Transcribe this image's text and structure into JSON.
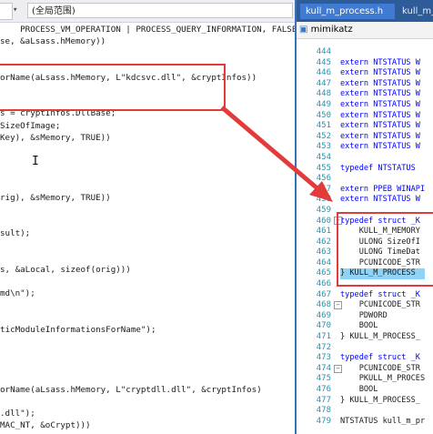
{
  "left_header": {
    "scope_label": "(全局范围)"
  },
  "left_code": [
    "    PROCESS_VM_OPERATION | PROCESS_QUERY_INFORMATION, FALSE, processId",
    "se, &aLsass.hMemory))",
    "",
    "",
    "orName(aLsass.hMemory, L\"kdcsvc.dll\", &cryptInfos))",
    "",
    "",
    "s = cryptInfos.DllBase;",
    "SizeOfImage;",
    "Key), &sMemory, TRUE))",
    "",
    "",
    "",
    "",
    "rig), &sMemory, TRUE))",
    "",
    "",
    "sult);",
    "",
    "",
    "s, &aLocal, sizeof(orig)))",
    "",
    "md\\n\");",
    "",
    "",
    "ticModuleInformationsForName\");",
    "",
    "",
    "",
    "",
    "orName(aLsass.hMemory, L\"cryptdll.dll\", &cryptInfos)",
    "",
    ".dll\");",
    "MAC_NT, &oCrypt)))"
  ],
  "right_tabs": {
    "active": "kull_m_process.h",
    "other": "kull_m_m"
  },
  "right_nav": {
    "project": "mimikatz"
  },
  "right_lines": [
    {
      "n": "444",
      "code": ""
    },
    {
      "n": "445",
      "code": "extern NTSTATUS W"
    },
    {
      "n": "446",
      "code": "extern NTSTATUS W"
    },
    {
      "n": "447",
      "code": "extern NTSTATUS W"
    },
    {
      "n": "448",
      "code": "extern NTSTATUS W"
    },
    {
      "n": "449",
      "code": "extern NTSTATUS W"
    },
    {
      "n": "450",
      "code": "extern NTSTATUS W"
    },
    {
      "n": "451",
      "code": "extern NTSTATUS W"
    },
    {
      "n": "452",
      "code": "extern NTSTATUS W"
    },
    {
      "n": "453",
      "code": "extern NTSTATUS W"
    },
    {
      "n": "454",
      "code": ""
    },
    {
      "n": "455",
      "code": "typedef NTSTATUS"
    },
    {
      "n": "456",
      "code": ""
    },
    {
      "n": "457",
      "code": "extern PPEB WINAPI"
    },
    {
      "n": "458",
      "code": "extern NTSTATUS W"
    },
    {
      "n": "459",
      "code": ""
    },
    {
      "n": "460",
      "code": "typedef struct _K"
    },
    {
      "n": "461",
      "code": "    KULL_M_MEMORY"
    },
    {
      "n": "462",
      "code": "    ULONG SizeOfI"
    },
    {
      "n": "463",
      "code": "    ULONG TimeDat"
    },
    {
      "n": "464",
      "code": "    PCUNICODE_STR"
    },
    {
      "n": "465",
      "code": "} KULL_M_PROCESS"
    },
    {
      "n": "466",
      "code": ""
    },
    {
      "n": "467",
      "code": "typedef struct _K"
    },
    {
      "n": "468",
      "code": "    PCUNICODE_STR"
    },
    {
      "n": "469",
      "code": "    PDWORD"
    },
    {
      "n": "470",
      "code": "    BOOL"
    },
    {
      "n": "471",
      "code": "} KULL_M_PROCESS_"
    },
    {
      "n": "472",
      "code": ""
    },
    {
      "n": "473",
      "code": "typedef struct _K"
    },
    {
      "n": "474",
      "code": "    PCUNICODE_STR"
    },
    {
      "n": "475",
      "code": "    PKULL_M_PROCES"
    },
    {
      "n": "476",
      "code": "    BOOL"
    },
    {
      "n": "477",
      "code": "} KULL_M_PROCESS_"
    },
    {
      "n": "478",
      "code": ""
    },
    {
      "n": "479",
      "code": "NTSTATUS kull_m_pr"
    }
  ],
  "colors": {
    "annotation_red": "#e23b3b",
    "tab_blue": "#3f7ad3",
    "highlight": "#8fd3f7"
  }
}
